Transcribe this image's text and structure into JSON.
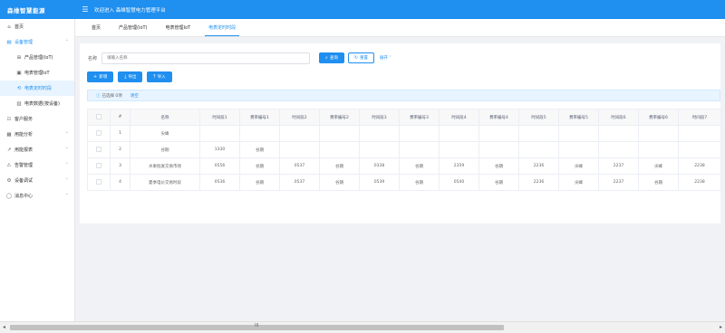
{
  "app": {
    "brand": "森维智慧能源",
    "welcome": "欢迎进入 森维智慧电力管理平台"
  },
  "sidebar": {
    "items": [
      {
        "label": "首页",
        "icon": "home-icon"
      },
      {
        "label": "设备管理",
        "icon": "device-icon",
        "arrow": "˄"
      },
      {
        "label": "产品管理(IoT)",
        "icon": "product-icon"
      },
      {
        "label": "电表管理IoT",
        "icon": "meter-icon"
      },
      {
        "label": "电表定时时段",
        "icon": "clock-icon"
      },
      {
        "label": "电表数据(按设备)",
        "icon": "data-icon"
      },
      {
        "label": "客户服务",
        "icon": "service-icon"
      },
      {
        "label": "用能分析",
        "icon": "analysis-icon",
        "arrow": "˅"
      },
      {
        "label": "用能报表",
        "icon": "report-icon",
        "arrow": "˅"
      },
      {
        "label": "告警管理",
        "icon": "alarm-icon",
        "arrow": "˅"
      },
      {
        "label": "设备调试",
        "icon": "debug-icon",
        "arrow": "˅"
      },
      {
        "label": "消息中心",
        "icon": "message-icon",
        "arrow": "˅"
      }
    ]
  },
  "tabs": [
    "首页",
    "产品管理(IoT)",
    "电表管理IoT",
    "电表定时时段"
  ],
  "search": {
    "label": "名称",
    "placeholder": "请输入名称",
    "search_btn": "查询",
    "reset_btn": "重置",
    "expand": "展开"
  },
  "toolbar": {
    "add": "新增",
    "export": "导出",
    "import": "导入"
  },
  "alert": {
    "selected": "已选择 0项",
    "clear": "清空"
  },
  "table": {
    "headers": [
      "#",
      "名称",
      "时间段1",
      "费率编号1",
      "时间段2",
      "费率编号2",
      "时间段3",
      "费率编号3",
      "时间段4",
      "费率编号4",
      "时间段5",
      "费率编号5",
      "时间段6",
      "费率编号6",
      "时间段7"
    ],
    "rows": [
      [
        "1",
        "尖峰",
        "",
        "",
        "",
        "",
        "",
        "",
        "",
        "",
        "",
        "",
        "",
        "",
        ""
      ],
      [
        "2",
        "谷期",
        "1330",
        "谷期",
        "",
        "",
        "",
        "",
        "",
        "",
        "",
        "",
        "",
        "",
        ""
      ],
      [
        "3",
        "水果批发交易市场",
        "0556",
        "谷期",
        "0537",
        "谷期",
        "0338",
        "谷期",
        "2359",
        "谷期",
        "2236",
        "尖峰",
        "2237",
        "尖峰",
        "2238"
      ],
      [
        "4",
        "夏季电价交易时段",
        "0536",
        "谷期",
        "0537",
        "谷期",
        "0539",
        "谷期",
        "0540",
        "谷期",
        "2236",
        "尖峰",
        "2237",
        "谷期",
        "2238"
      ]
    ]
  },
  "scrollbar": {
    "grip": "III"
  }
}
